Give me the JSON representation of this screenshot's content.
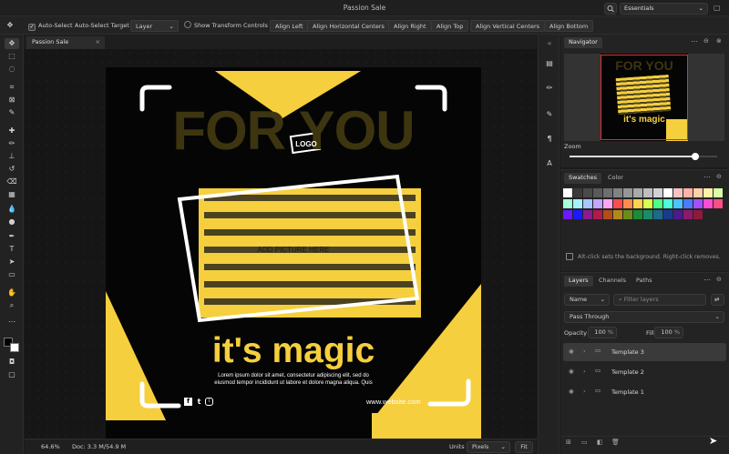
{
  "app": {
    "title": "Passion Sale",
    "workspace": "Essentials"
  },
  "toolbar": {
    "auto_select_label": "Auto-Select",
    "auto_select_target_label": "Auto-Select Target",
    "target_value": "Layer",
    "show_transform_label": "Show Transform Controls",
    "align_left": "Align Left",
    "align_hcenter": "Align Horizontal Centers",
    "align_right": "Align Right",
    "align_top": "Align Top",
    "align_vcenter": "Align Vertical Centers",
    "align_bottom": "Align Bottom"
  },
  "document": {
    "tab_label": "Passion Sale",
    "close_glyph": "×"
  },
  "artboard": {
    "headline": "FOR YOU",
    "logo": "LOGO",
    "picture_placeholder": "ADD PICTURE HERE",
    "tagline": "it's magic",
    "body_line1": "Lorem ipsum dolor sit amet, consectetur adipiscing elit, sed do",
    "body_line2": "eiusmod tempor incididunt ut labore et dolore magna aliqua. Quis",
    "website": "www.website.com",
    "social": [
      "f",
      "t",
      "i"
    ],
    "colors": {
      "yellow": "#f5cf3d",
      "dark_yellow": "#3d3510",
      "black": "#050505"
    }
  },
  "status": {
    "zoom": "64.6%",
    "doc_info": "Doc: 3.3 M/54.9 M",
    "units_label": "Units",
    "units_value": "Pixels",
    "fit_label": "Fit"
  },
  "navigator": {
    "tab": "Navigator",
    "mini_tagline": "it's magic",
    "mini_headline": "FOR YOU",
    "zoom_label": "Zoom",
    "zoom_level": 0.85
  },
  "swatches": {
    "tabs": [
      "Swatches",
      "Color"
    ],
    "hint": "Alt-click sets the background. Right-click removes.",
    "rows": [
      [
        "#ffffff",
        "#3a3a3a",
        "#4a4a4a",
        "#5a5a5a",
        "#6e6e6e",
        "#828282",
        "#969696",
        "#aaaaaa",
        "#bebebe",
        "#d2d2d2",
        "#ffffff",
        "#f4c2c2",
        "#ffb3a6",
        "#ffd1a6",
        "#fff2a6",
        "#d9ffa6"
      ],
      [
        "#a6ffd9",
        "#a6f2ff",
        "#a6c8ff",
        "#c2a6ff",
        "#ffa6f2",
        "#ff4d4d",
        "#ff8c4d",
        "#ffd24d",
        "#d9ff4d",
        "#4dff88",
        "#4dffd9",
        "#4dc3ff",
        "#4d79ff",
        "#a64dff",
        "#ff4dd2",
        "#ff4d88"
      ],
      [
        "#6a1aff",
        "#1a1aff",
        "#8c1a8c",
        "#b21a4d",
        "#b24d1a",
        "#b2891a",
        "#6b8c1a",
        "#1a8c3a",
        "#1a8c6b",
        "#1a6b8c",
        "#1a3a8c",
        "#4d1a8c",
        "#8c1a6b",
        "#8c1a3a"
      ]
    ]
  },
  "layers": {
    "tabs": [
      "Layers",
      "Channels",
      "Paths"
    ],
    "filter_type": "Name",
    "filter_placeholder": "Filter layers",
    "blend_mode": "Pass Through",
    "opacity_label": "Opacity",
    "opacity_value": "100",
    "fill_label": "Fill",
    "fill_value": "100",
    "percent": "%",
    "items": [
      "Template 3",
      "Template 2",
      "Template 1"
    ],
    "selected_index": 0
  }
}
